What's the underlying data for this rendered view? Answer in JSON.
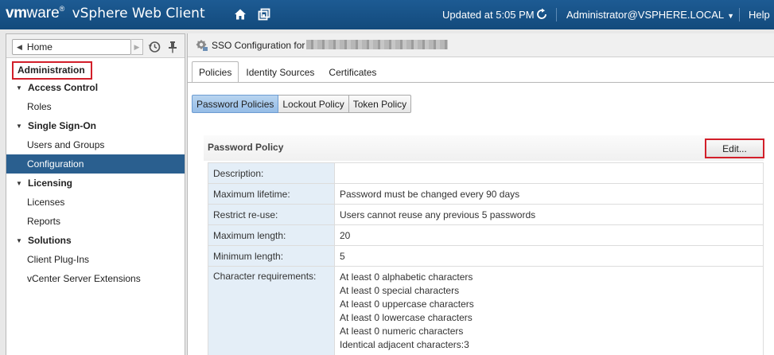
{
  "topbar": {
    "brand_vm": "vm",
    "brand_ware": "ware",
    "brand_registered": "®",
    "product": "vSphere Web Client",
    "updated": "Updated at 5:05 PM",
    "user": "Administrator@VSPHERE.LOCAL",
    "help": "Help",
    "icons": {
      "home": "home-icon",
      "window": "window-icon",
      "refresh": "refresh-icon"
    },
    "colors": {
      "bar": "#1d5b93"
    }
  },
  "nav": {
    "home_label": "Home",
    "admin_label": "Administration",
    "items": [
      {
        "label": "Access Control",
        "type": "group"
      },
      {
        "label": "Roles",
        "type": "leaf"
      },
      {
        "label": "Single Sign-On",
        "type": "group"
      },
      {
        "label": "Users and Groups",
        "type": "leaf"
      },
      {
        "label": "Configuration",
        "type": "leaf",
        "selected": true
      },
      {
        "label": "Licensing",
        "type": "group"
      },
      {
        "label": "Licenses",
        "type": "leaf"
      },
      {
        "label": "Reports",
        "type": "leaf"
      },
      {
        "label": "Solutions",
        "type": "group"
      },
      {
        "label": "Client Plug-Ins",
        "type": "leaf"
      },
      {
        "label": "vCenter Server Extensions",
        "type": "leaf"
      }
    ],
    "colors": {
      "selected": "#2a5f8f",
      "highlight": "#d21f2a"
    }
  },
  "main": {
    "title": "SSO Configuration for",
    "tabs": [
      "Policies",
      "Identity Sources",
      "Certificates"
    ],
    "subtabs": [
      "Password Policies",
      "Lockout Policy",
      "Token Policy"
    ],
    "panel_title": "Password Policy",
    "edit_label": "Edit...",
    "rows": [
      {
        "key": "Description:",
        "value": ""
      },
      {
        "key": "Maximum lifetime:",
        "value": "Password must be changed every 90 days"
      },
      {
        "key": "Restrict re-use:",
        "value": "Users cannot reuse any previous 5 passwords"
      },
      {
        "key": "Maximum length:",
        "value": "20"
      },
      {
        "key": "Minimum length:",
        "value": "5"
      }
    ],
    "char_req_key": "Character requirements:",
    "char_req_lines": [
      "At least 0 alphabetic characters",
      "At least 0 special characters",
      "At least 0 uppercase characters",
      "At least 0 lowercase characters",
      "At least 0 numeric characters",
      "Identical adjacent characters:3"
    ]
  }
}
